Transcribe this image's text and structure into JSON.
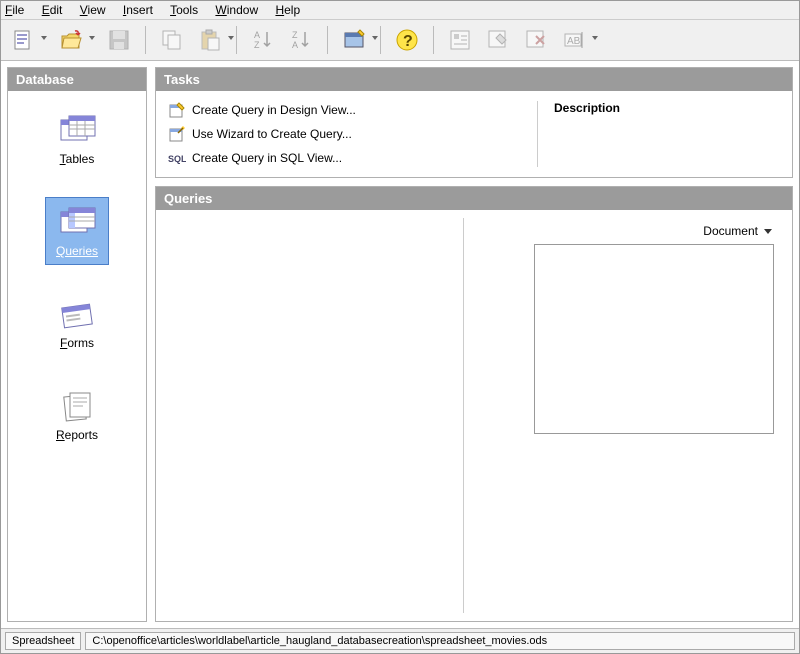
{
  "sidebar": {
    "header": "Database",
    "items": [
      {
        "label": "Tables",
        "u": "T"
      },
      {
        "label": "Queries",
        "u": "Q"
      },
      {
        "label": "Forms",
        "u": "F"
      },
      {
        "label": "Reports",
        "u": "R"
      }
    ]
  },
  "tasks": {
    "header": "Tasks",
    "items": [
      "Create Query in Design View...",
      "Use Wizard to Create Query...",
      "Create Query in SQL View..."
    ],
    "descriptionLabel": "Description"
  },
  "queries": {
    "header": "Queries",
    "documentLabel": "Document"
  },
  "status": {
    "type": "Spreadsheet",
    "path": "C:\\openoffice\\articles\\worldlabel\\article_haugland_databasecreation\\spreadsheet_movies.ods"
  }
}
